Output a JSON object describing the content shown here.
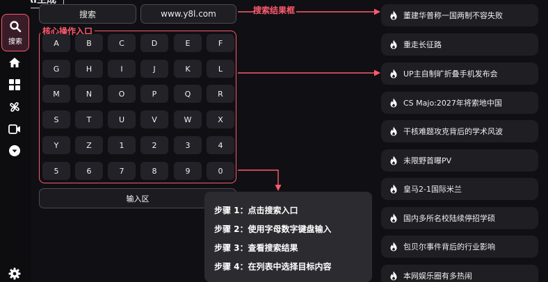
{
  "app": {
    "logo_text": "AI生成"
  },
  "sidebar": {
    "search_label": "搜索",
    "items": [
      {
        "icon": "home-icon"
      },
      {
        "icon": "grid-icon"
      },
      {
        "icon": "fan-icon"
      },
      {
        "icon": "video-icon"
      },
      {
        "icon": "chevron-down-circle-icon"
      }
    ],
    "settings_icon": "gear-icon"
  },
  "search": {
    "button_label": "搜索",
    "url_value": "www.y8l.com",
    "annotation": "搜索结果框"
  },
  "keyboard": {
    "annotation": "核心操作入口",
    "rows": [
      [
        "A",
        "B",
        "C",
        "D",
        "E",
        "F"
      ],
      [
        "G",
        "H",
        "I",
        "J",
        "K",
        "L"
      ],
      [
        "M",
        "N",
        "O",
        "P",
        "Q",
        "R"
      ],
      [
        "S",
        "T",
        "U",
        "V",
        "W",
        "X"
      ],
      [
        "Y",
        "Z",
        "1",
        "2",
        "3",
        "4"
      ],
      [
        "5",
        "6",
        "7",
        "8",
        "9",
        "0"
      ]
    ],
    "input_label": "输入区"
  },
  "steps": [
    "步骤 1：点击搜索入口",
    "步骤 2：使用字母数字键盘输入",
    "步骤 3：查看搜索结果",
    "步骤 4：在列表中选择目标内容"
  ],
  "results": [
    "董建华普称一国两制不容失败",
    "重走长征路",
    "UP主自制旷折叠手机发布会",
    "CS Majo:2027年将索地中国",
    "干核难题攻克背后的学术风波",
    "未限野首曝PV",
    "皇马2-1国际米兰",
    "国内多所名校陆续停招学硕",
    "包贝尔事件背后的行业影响",
    "本网娱乐圈有多热闹"
  ],
  "colors": {
    "accent": "#ff5a6e",
    "background": "#101014",
    "key_bg": "#222228",
    "panel_bg": "#2b2b30"
  }
}
